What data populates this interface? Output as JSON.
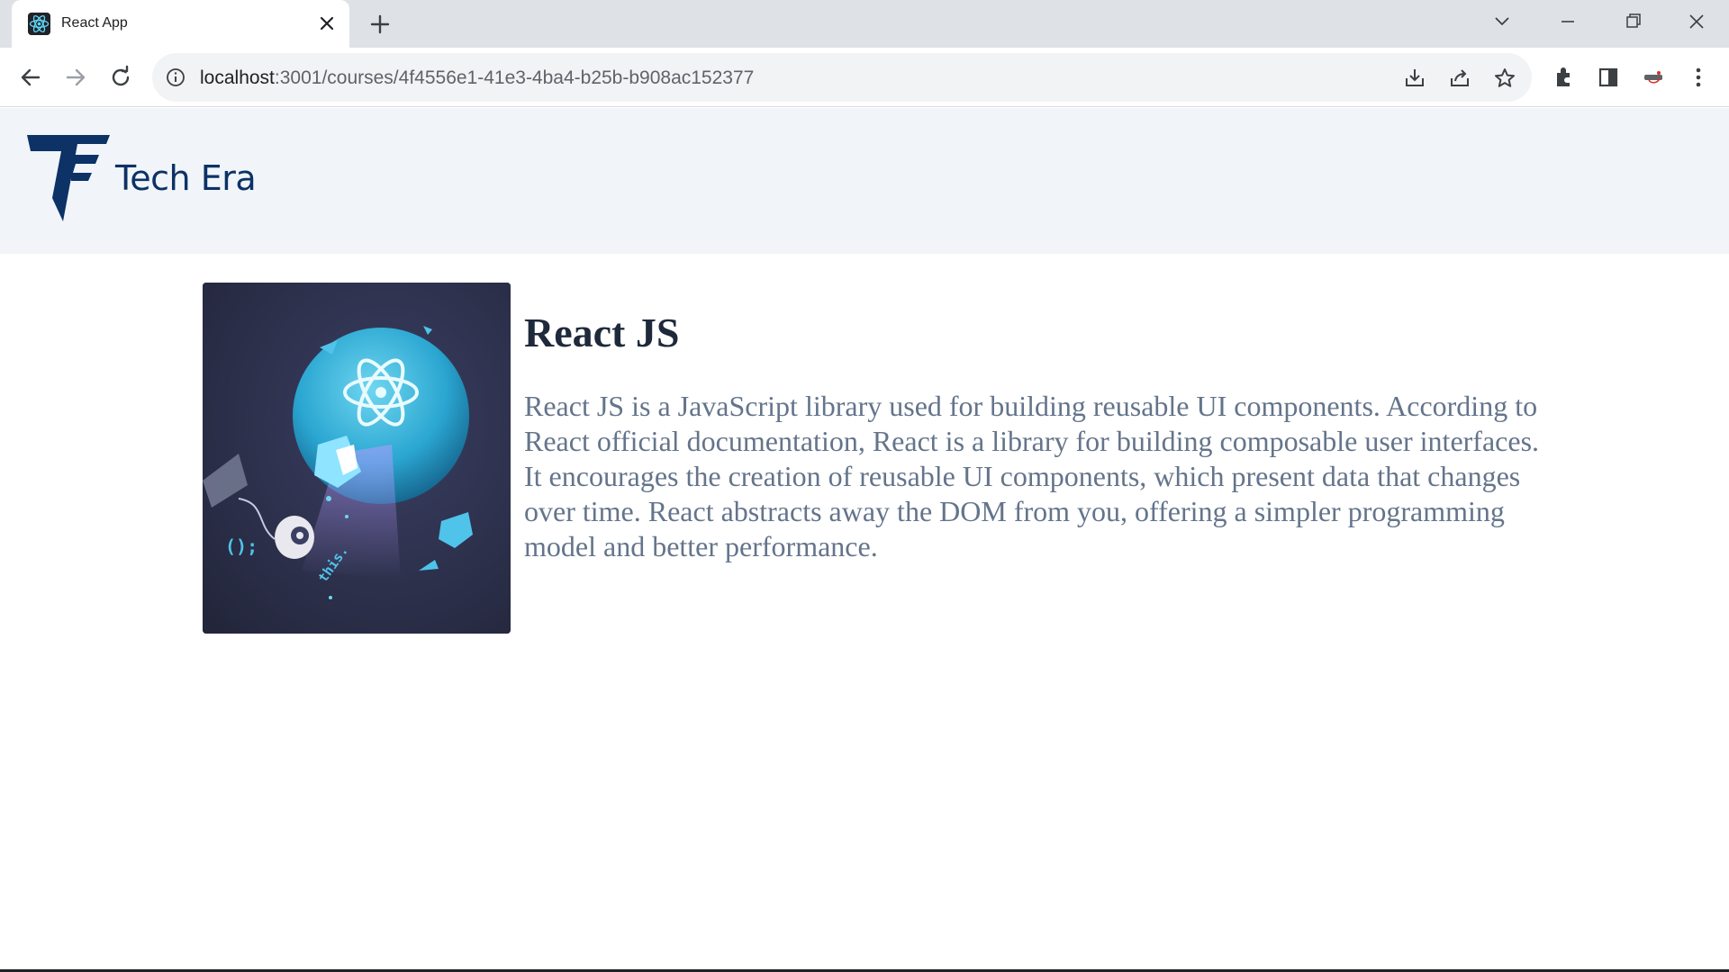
{
  "browser": {
    "tab_title": "React App",
    "url_host": "localhost",
    "url_rest": ":3001/courses/4f4556e1-41e3-4ba4-b25b-b908ac152377",
    "favicon": "react-logo-icon"
  },
  "site": {
    "brand": "Tech Era",
    "logo": "tech-era-logo"
  },
  "course": {
    "name": "React JS",
    "description": "React JS is a JavaScript library used for building reusable UI components. According to React official documentation, React is a library for building composable user interfaces. It encourages the creation of reusable UI components, which present data that changes over time. React abstracts away the DOM from you, offering a simpler programming model and better performance.",
    "image_text": "this.",
    "image_code": "();"
  },
  "colors": {
    "header_bg": "#f1f5f9",
    "brand": "#0c3266",
    "title": "#1e293b",
    "description": "#64748b"
  }
}
